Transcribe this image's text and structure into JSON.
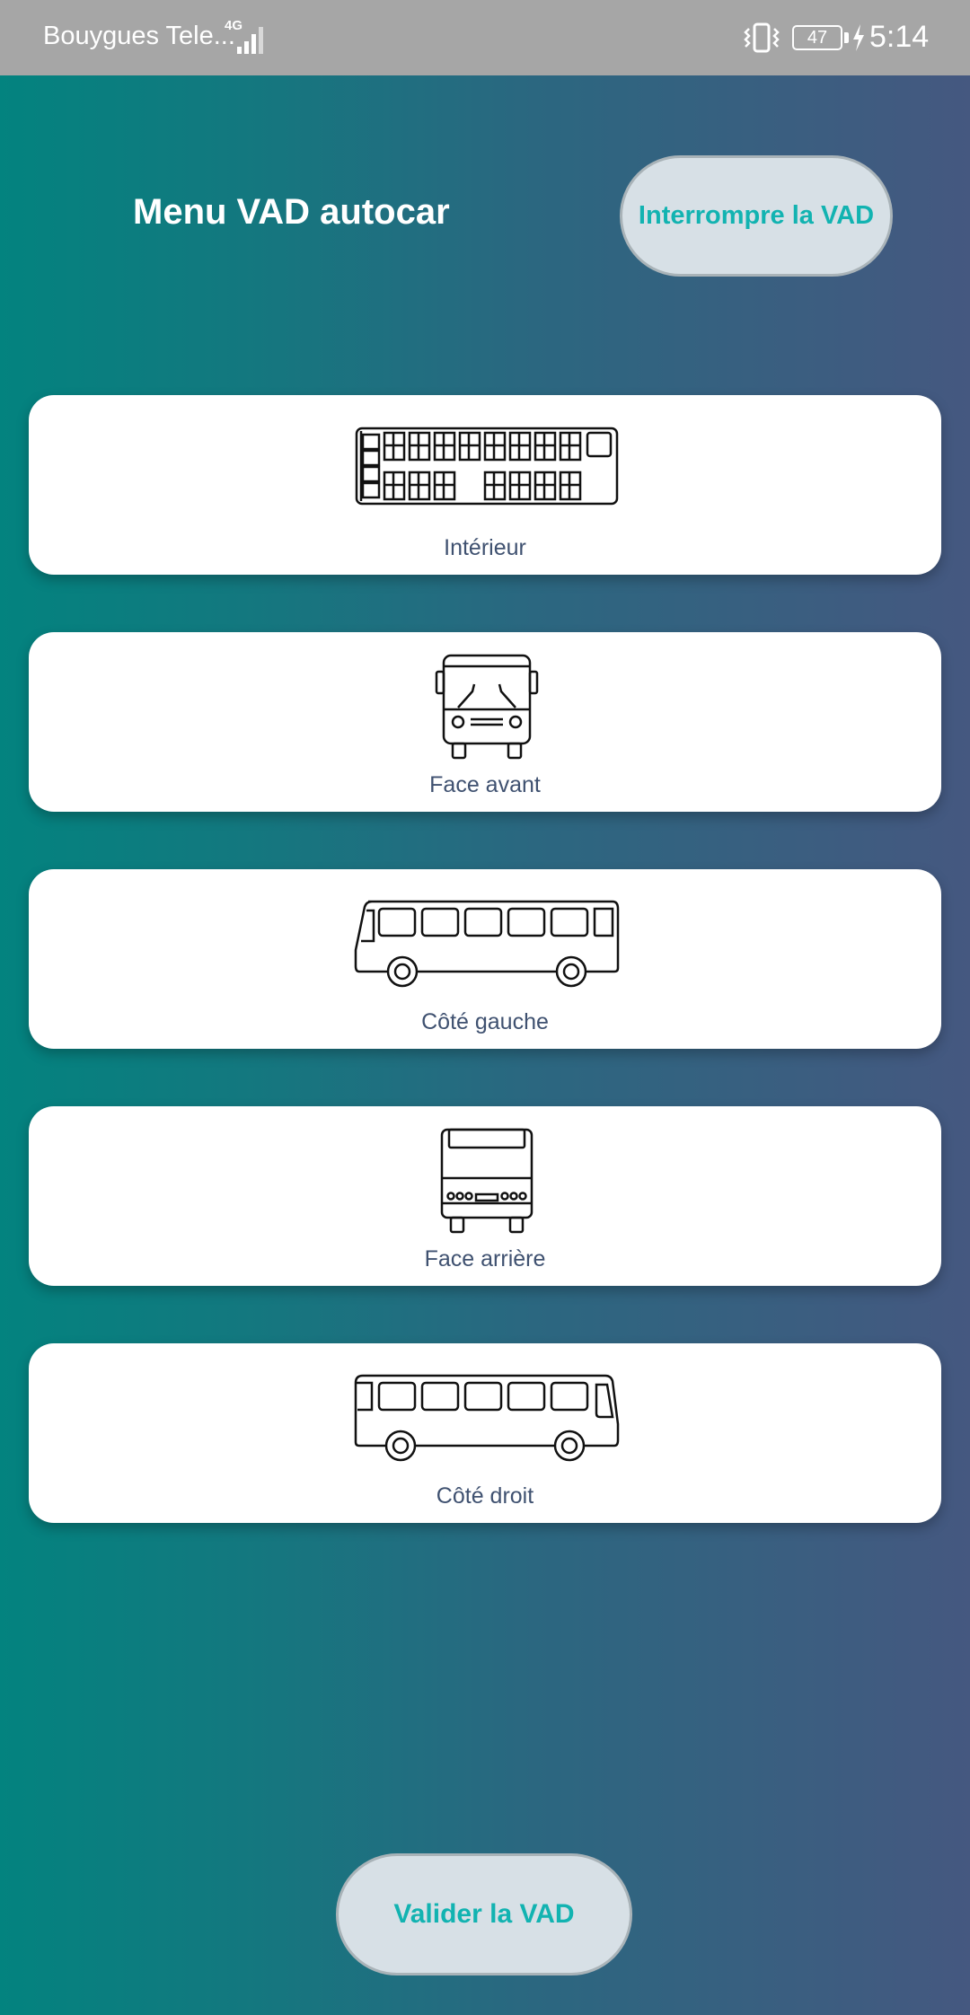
{
  "status_bar": {
    "carrier": "Bouygues Tele...",
    "network_type": "4G",
    "battery_level": "47",
    "time": "5:14",
    "icons": [
      "signal-icon",
      "vibrate-icon",
      "battery-icon",
      "charging-icon"
    ]
  },
  "header": {
    "title": "Menu VAD autocar",
    "stop_button": "Interrompre la VAD"
  },
  "menu_items": [
    {
      "label": "Intérieur",
      "icon": "bus-interior-icon"
    },
    {
      "label": "Face avant",
      "icon": "bus-front-icon"
    },
    {
      "label": "Côté gauche",
      "icon": "bus-left-side-icon"
    },
    {
      "label": "Face arrière",
      "icon": "bus-rear-icon"
    },
    {
      "label": "Côté droit",
      "icon": "bus-right-side-icon"
    }
  ],
  "footer": {
    "validate_button": "Valider la VAD"
  },
  "colors": {
    "gradient_start": "#03837f",
    "gradient_end": "#455880",
    "button_text": "#12b3b1",
    "button_bg": "#d7e0e6",
    "card_label": "#3f5170",
    "status_bar": "#a6a6a6"
  }
}
